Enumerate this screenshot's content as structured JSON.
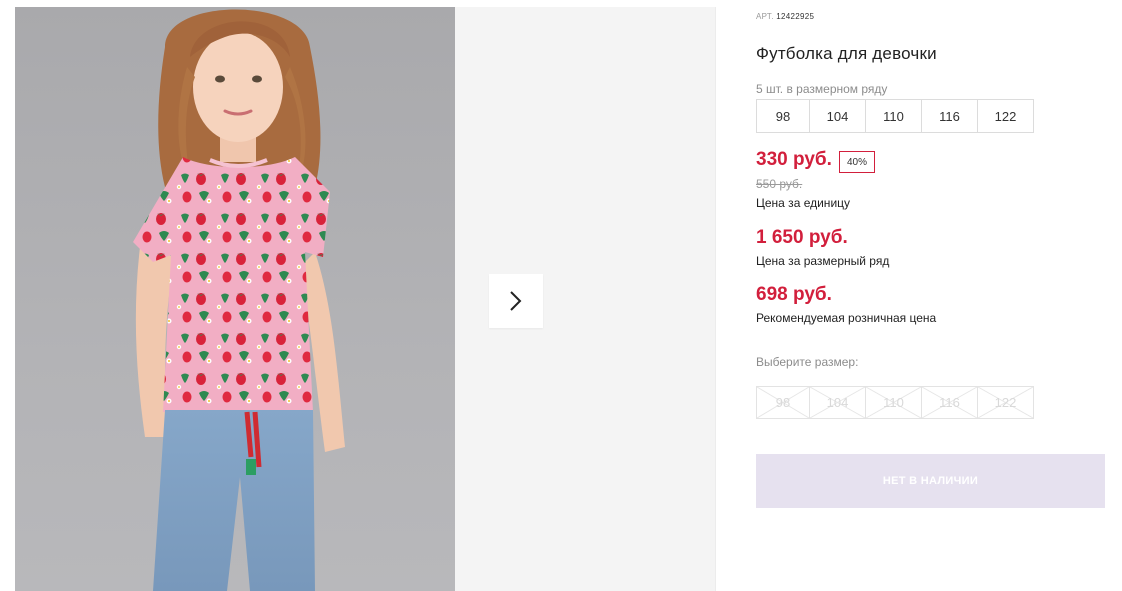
{
  "gallery": {
    "photo_alt": "product-photo",
    "next_icon": "chevron-right-icon"
  },
  "product": {
    "art_label": "АРТ.",
    "art_number": "12422925",
    "title": "Футболка для девочки",
    "size_note": "5 шт. в размерном ряду",
    "sizes": [
      "98",
      "104",
      "110",
      "116",
      "122"
    ]
  },
  "prices": {
    "unit_price": "330 руб.",
    "discount": "40%",
    "old_price": "550 руб.",
    "unit_caption": "Цена за единицу",
    "row_price": "1 650 руб.",
    "row_caption": "Цена за размерный ряд",
    "retail_price": "698 руб.",
    "retail_caption": "Рекомендуемая розничная цена"
  },
  "size_picker": {
    "label": "Выберите размер:",
    "options": [
      "98",
      "104",
      "110",
      "116",
      "122"
    ]
  },
  "cta": {
    "label": "НЕТ В НАЛИЧИИ"
  },
  "colors": {
    "price_red": "#d21f3c",
    "cta_bg": "#e6e1ef"
  }
}
